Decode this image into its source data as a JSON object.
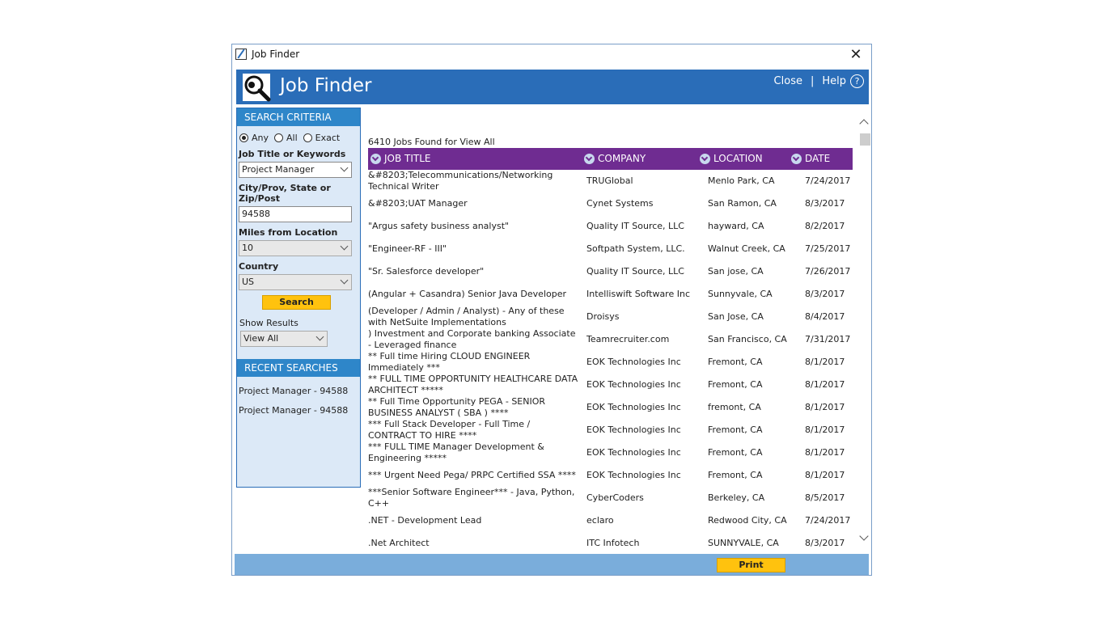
{
  "window": {
    "title": "Job Finder",
    "close_glyph": "✕"
  },
  "banner": {
    "title": "Job Finder",
    "close_label": "Close",
    "separator": "|",
    "help_label": "Help",
    "help_glyph": "?",
    "color": "#2a6db8"
  },
  "search": {
    "header": "SEARCH CRITERIA",
    "match_options": [
      "Any",
      "All",
      "Exact"
    ],
    "match_selected": "Any",
    "keywords_label": "Job Title or Keywords",
    "keywords_value": "Project Manager",
    "location_label": "City/Prov, State or Zip/Post",
    "location_value": "94588",
    "miles_label": "Miles from Location",
    "miles_value": "10",
    "country_label": "Country",
    "country_value": "US",
    "search_button": "Search",
    "show_results_label": "Show Results",
    "show_results_value": "View All"
  },
  "recent": {
    "header": "RECENT SEARCHES",
    "items": [
      "Project Manager - 94588",
      "Project Manager - 94588"
    ]
  },
  "results": {
    "count_text": "6410 Jobs Found for View All",
    "header_color": "#6f2c91",
    "columns": [
      "JOB TITLE",
      "COMPANY",
      "LOCATION",
      "DATE"
    ],
    "rows": [
      [
        "&#8203;Telecommunications/Networking Technical Writer",
        "TRUGlobal",
        "Menlo Park, CA",
        "7/24/2017"
      ],
      [
        "&#8203;UAT Manager",
        "Cynet Systems",
        "San Ramon, CA",
        "8/3/2017"
      ],
      [
        "\"Argus safety business analyst\"",
        "Quality IT Source, LLC",
        "hayward, CA",
        "8/2/2017"
      ],
      [
        "\"Engineer-RF - III\"",
        "Softpath System, LLC.",
        "Walnut Creek, CA",
        "7/25/2017"
      ],
      [
        "\"Sr. Salesforce developer\"",
        "Quality IT Source, LLC",
        "San jose, CA",
        "7/26/2017"
      ],
      [
        "(Angular + Casandra) Senior Java Developer",
        "Intelliswift Software Inc",
        "Sunnyvale, CA",
        "8/3/2017"
      ],
      [
        "(Developer / Admin / Analyst) - Any of these with NetSuite Implementations",
        "Droisys",
        "San Jose, CA",
        "8/4/2017"
      ],
      [
        ") Investment and Corporate banking Associate - Leveraged finance",
        "Teamrecruiter.com",
        "San Francisco, CA",
        "7/31/2017"
      ],
      [
        "** Full time Hiring CLOUD ENGINEER Immediately ***",
        "EOK Technologies Inc",
        "Fremont, CA",
        "8/1/2017"
      ],
      [
        "** FULL TIME OPPORTUNITY HEALTHCARE DATA ARCHITECT *****",
        "EOK Technologies Inc",
        "Fremont, CA",
        "8/1/2017"
      ],
      [
        "** Full Time Opportunity PEGA - SENIOR BUSINESS ANALYST ( SBA ) ****",
        "EOK Technologies Inc",
        "fremont, CA",
        "8/1/2017"
      ],
      [
        "*** Full Stack Developer - Full Time / CONTRACT TO HIRE ****",
        "EOK Technologies Inc",
        "Fremont, CA",
        "8/1/2017"
      ],
      [
        "*** FULL TIME Manager Development & Engineering *****",
        "EOK Technologies Inc",
        "Fremont, CA",
        "8/1/2017"
      ],
      [
        "*** Urgent Need Pega/ PRPC Certified SSA ****",
        "EOK Technologies Inc",
        "Fremont, CA",
        "8/1/2017"
      ],
      [
        "***Senior Software Engineer*** - Java, Python, C++",
        "CyberCoders",
        "Berkeley, CA",
        "8/5/2017"
      ],
      [
        ".NET - Development Lead",
        "eclaro",
        "Redwood City, CA",
        "7/24/2017"
      ],
      [
        ".Net Architect",
        "ITC Infotech",
        "SUNNYVALE, CA",
        "8/3/2017"
      ]
    ]
  },
  "footer": {
    "print_button": "Print"
  }
}
